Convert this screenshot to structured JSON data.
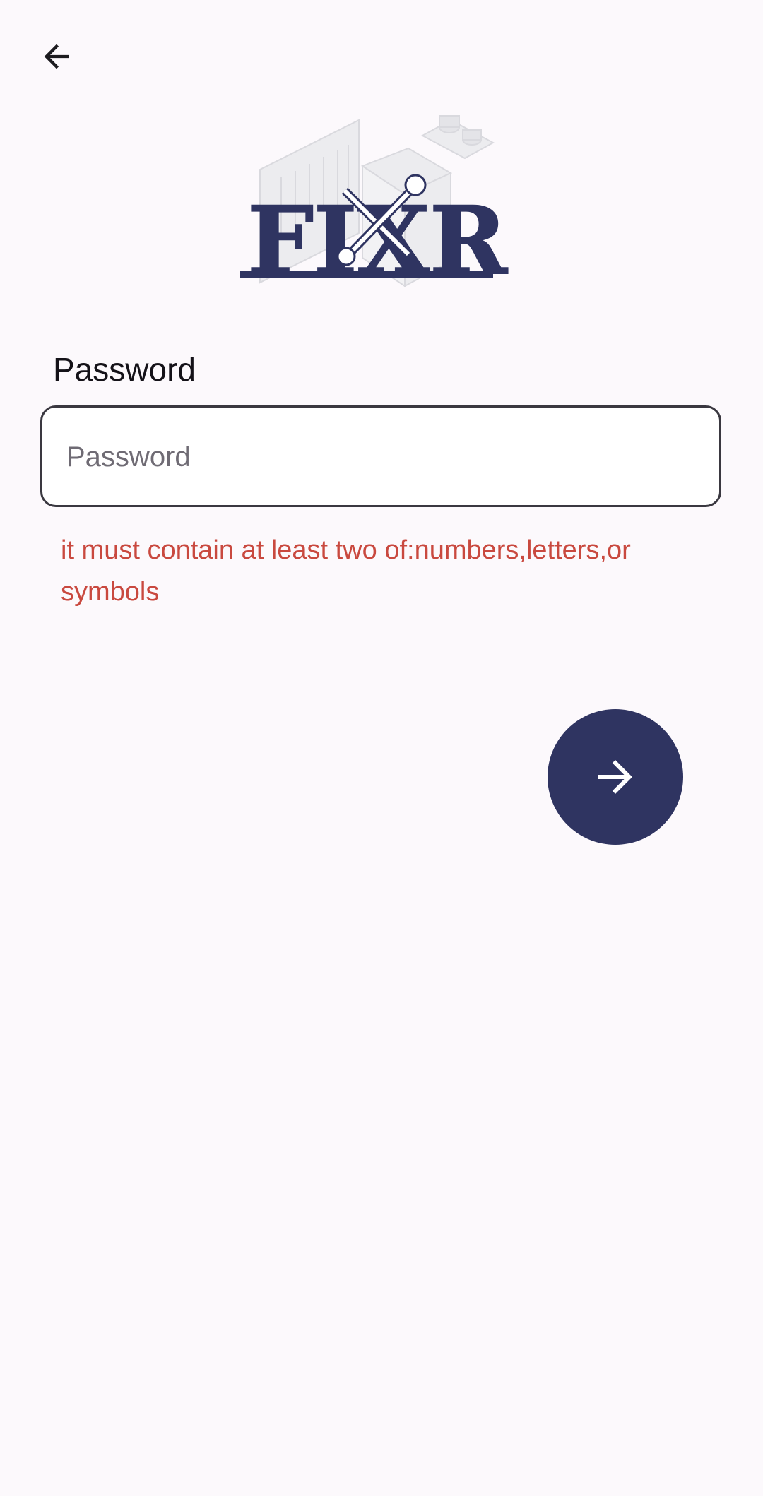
{
  "app": {
    "logo_text": "FIXR"
  },
  "toolbar": {
    "back_icon": "arrow-left-icon"
  },
  "password_field": {
    "label": "Password",
    "placeholder": "Password",
    "value": ""
  },
  "validation": {
    "error": "it must contain at least two of:numbers,letters,or symbols"
  },
  "next_button": {
    "icon": "arrow-right-icon"
  },
  "colors": {
    "background": "#fcf9fc",
    "primary": "#2f3461",
    "error": "#c9493f",
    "outline": "#3a3840"
  }
}
